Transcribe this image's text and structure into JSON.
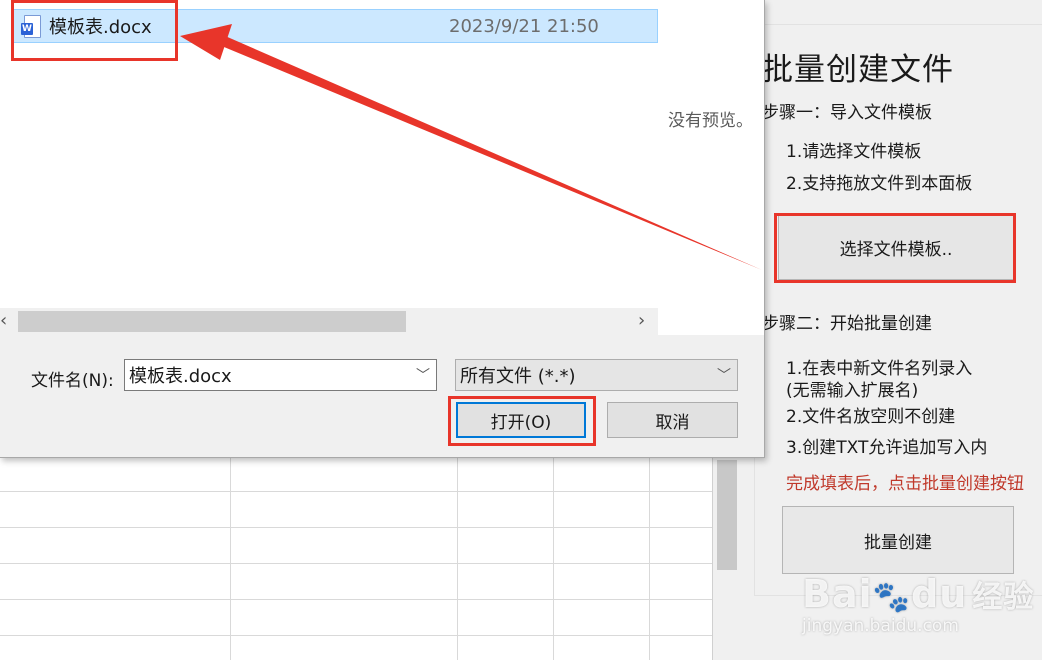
{
  "file_dialog": {
    "files": [
      {
        "name": "模板表.docx",
        "date": "2023/9/21 21:50",
        "selected": true,
        "type": "word"
      }
    ],
    "preview_text": "没有预览。",
    "filename_label": "文件名(N):",
    "filename_value": "模板表.docx",
    "filetype_value": "所有文件 (*.*)",
    "open_label": "打开(O)",
    "cancel_label": "取消"
  },
  "panel": {
    "title": "批量创建文件",
    "step1_heading": "步骤一：导入文件模板",
    "step1_items": [
      "1.请选择文件模板",
      "2.支持拖放文件到本面板"
    ],
    "select_template_label": "选择文件模板..",
    "step2_heading": "步骤二：开始批量创建",
    "step2_items": [
      "1.在表中新文件名列录入",
      "(无需输入扩展名)",
      "2.文件名放空则不创建",
      "3.创建TXT允许追加写入内"
    ],
    "step2_note": "完成填表后，点击批量创建按钮",
    "batch_create_label": "批量创建"
  },
  "watermark": {
    "brand": "Bai",
    "brand2": "du",
    "suffix": "经验",
    "url": "jingyan.baidu.com"
  },
  "colors": {
    "annotation_red": "#e8352a",
    "selection": "#cce8ff",
    "primary_border": "#0078d7",
    "note_red": "#c0392b"
  }
}
